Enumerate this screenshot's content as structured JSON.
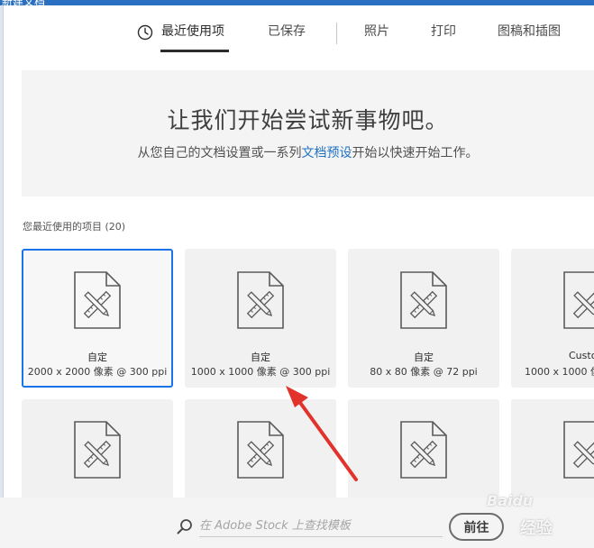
{
  "window": {
    "title": "新建文档"
  },
  "tabs": [
    {
      "label": "最近使用项",
      "active": true,
      "icon": "clock-icon"
    },
    {
      "label": "已保存",
      "active": false
    },
    {
      "label": "照片",
      "active": false
    },
    {
      "label": "打印",
      "active": false
    },
    {
      "label": "图稿和插图",
      "active": false
    }
  ],
  "hero": {
    "title": "让我们开始尝试新事物吧。",
    "subtitle_before": "从您自己的文档设置或一系列",
    "subtitle_link": "文档预设",
    "subtitle_after": "开始以快速开始工作。"
  },
  "recent": {
    "label": "您最近使用的项目",
    "count": "(20)",
    "items": [
      {
        "name": "自定",
        "meta": "2000 x 2000 像素 @ 300 ppi",
        "selected": true,
        "icon": "document-icon"
      },
      {
        "name": "自定",
        "meta": "1000 x 1000 像素 @ 300 ppi",
        "selected": false,
        "icon": "document-icon"
      },
      {
        "name": "自定",
        "meta": "80 x 80 像素 @ 72 ppi",
        "selected": false,
        "icon": "document-icon"
      },
      {
        "name": "Custo",
        "meta": "1000 x 1000 像",
        "selected": false,
        "icon": "document-icon"
      },
      {
        "name": "",
        "meta": "",
        "selected": false,
        "icon": "document-icon"
      },
      {
        "name": "",
        "meta": "",
        "selected": false,
        "icon": "document-icon"
      },
      {
        "name": "",
        "meta": "",
        "selected": false,
        "icon": "document-icon"
      },
      {
        "name": "",
        "meta": "",
        "selected": false,
        "icon": "document-icon"
      }
    ]
  },
  "search": {
    "placeholder": "在 Adobe Stock 上查找模板",
    "icon": "search-icon"
  },
  "go_button": {
    "label": "前往"
  },
  "watermark": {
    "logo": "Baidu",
    "text": "经验"
  },
  "colors": {
    "accent": "#1a73e8",
    "link": "#1f72c2",
    "arrow": "#e2322c",
    "card_bg": "#f1f1f1",
    "titlebar": "#2b6fc2"
  }
}
